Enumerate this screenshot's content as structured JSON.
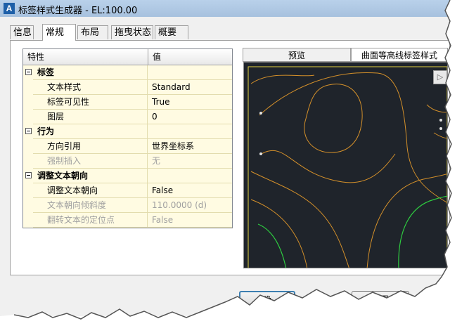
{
  "window": {
    "title": "标签样式生成器 - EL:100.00",
    "icon_letter": "A"
  },
  "tabs": [
    {
      "label": "信息",
      "active": false
    },
    {
      "label": "常规",
      "active": true
    },
    {
      "label": "布局",
      "active": false
    },
    {
      "label": "拖曳状态",
      "active": false
    },
    {
      "label": "概要",
      "active": false
    }
  ],
  "grid": {
    "col_property": "特性",
    "col_value": "值",
    "rows": [
      {
        "type": "category",
        "name": "标签",
        "value": ""
      },
      {
        "type": "item",
        "name": "文本样式",
        "value": "Standard",
        "disabled": false
      },
      {
        "type": "item",
        "name": "标签可见性",
        "value": "True",
        "disabled": false
      },
      {
        "type": "item",
        "name": "图层",
        "value": "0",
        "disabled": false
      },
      {
        "type": "category",
        "name": "行为",
        "value": ""
      },
      {
        "type": "item",
        "name": "方向引用",
        "value": "世界坐标系",
        "disabled": false
      },
      {
        "type": "item",
        "name": "强制插入",
        "value": "无",
        "disabled": true
      },
      {
        "type": "category",
        "name": "调整文本朝向",
        "value": ""
      },
      {
        "type": "item",
        "name": "调整文本朝向",
        "value": "False",
        "disabled": false
      },
      {
        "type": "item",
        "name": "文本朝向倾斜度",
        "value": "110.0000 (d)",
        "disabled": true
      },
      {
        "type": "item",
        "name": "翻转文本的定位点",
        "value": "False",
        "disabled": true
      }
    ]
  },
  "preview": {
    "tab_label": "预览",
    "style_select": "曲面等高线标签样式",
    "background_color": "#1f242b",
    "contour_color": "#d4902a",
    "highlight_color": "#2ecc40",
    "border_color": "#e0d040"
  },
  "footer": {
    "ok_partial": "确",
    "apply_partial": "应用"
  }
}
